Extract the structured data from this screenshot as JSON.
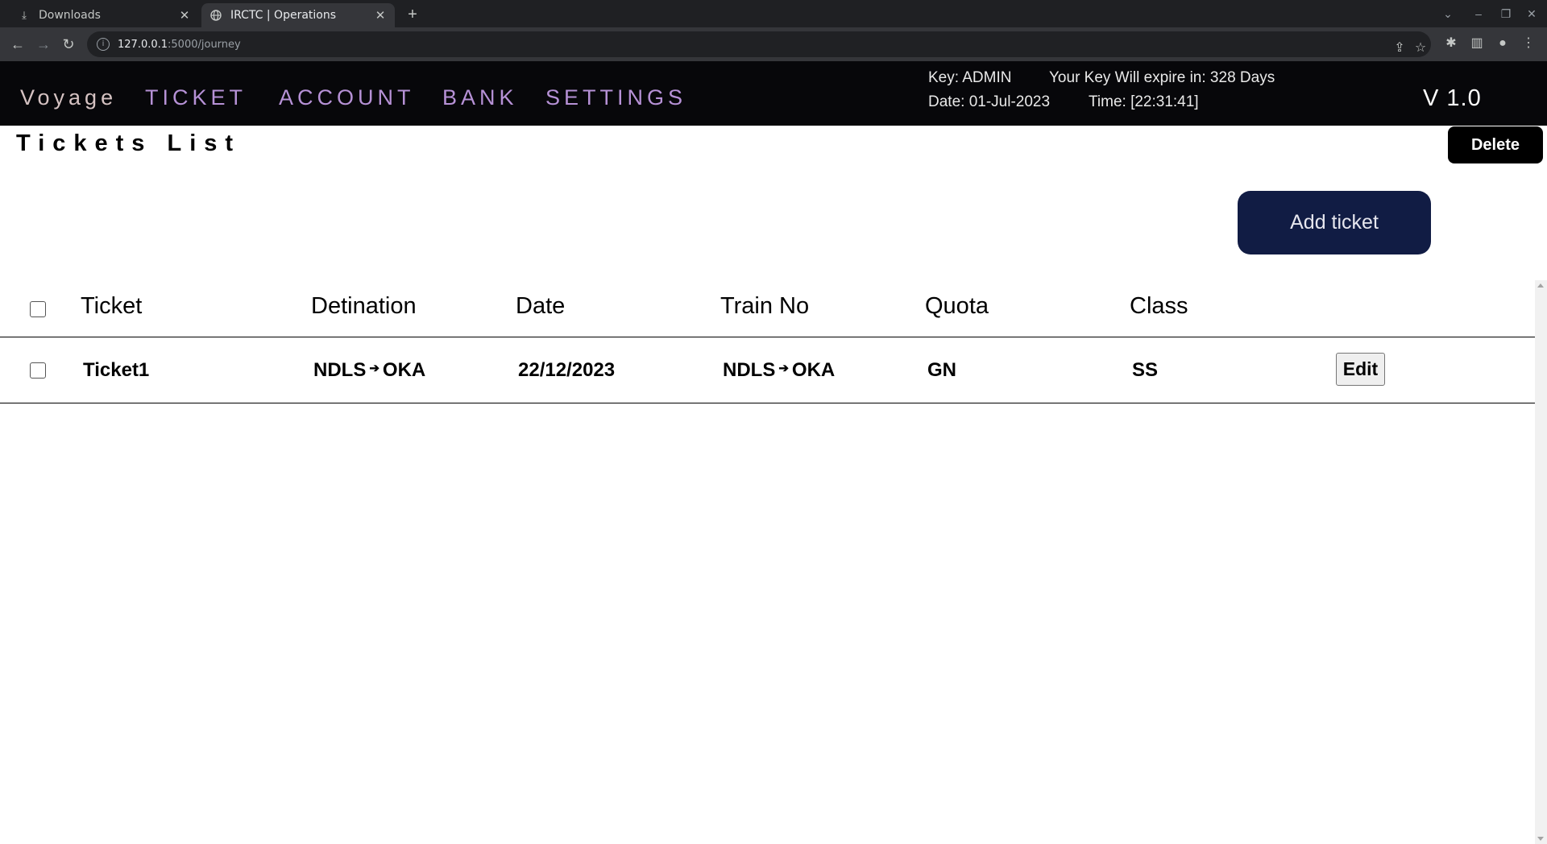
{
  "browser": {
    "tabs": [
      {
        "label": "Downloads",
        "icon": "download-icon",
        "active": false
      },
      {
        "label": "IRCTC | Operations",
        "icon": "globe-icon",
        "active": true
      }
    ],
    "url_host": "127.0.0.1",
    "url_path": ":5000/journey"
  },
  "nav": {
    "brand": "Voyage",
    "menu": [
      "TICKET",
      "ACCOUNT",
      "BANK",
      "SETTINGS"
    ],
    "key": "Key: ADMIN",
    "expiry": "Your Key Will expire in: 328 Days",
    "date": "Date: 01-Jul-2023",
    "time": "Time: [22:31:41]",
    "version": "V 1.0"
  },
  "page": {
    "title": "Tickets List",
    "delete_label": "Delete",
    "add_label": "Add ticket"
  },
  "table": {
    "headers": [
      "Ticket",
      "Detination",
      "Date",
      "Train No",
      "Quota",
      "Class"
    ],
    "rows": [
      {
        "ticket": "Ticket1",
        "dest_from": "NDLS",
        "dest_to": "OKA",
        "date": "22/12/2023",
        "train_from": "NDLS",
        "train_to": "OKA",
        "quota": "GN",
        "class": "SS",
        "edit_label": "Edit"
      }
    ]
  },
  "colors": {
    "nav_bg": "#07070a",
    "menu_text": "#b691d6",
    "brand_text": "#d5c2c2",
    "add_button_bg": "#111c44",
    "delete_button_bg": "#000000"
  }
}
